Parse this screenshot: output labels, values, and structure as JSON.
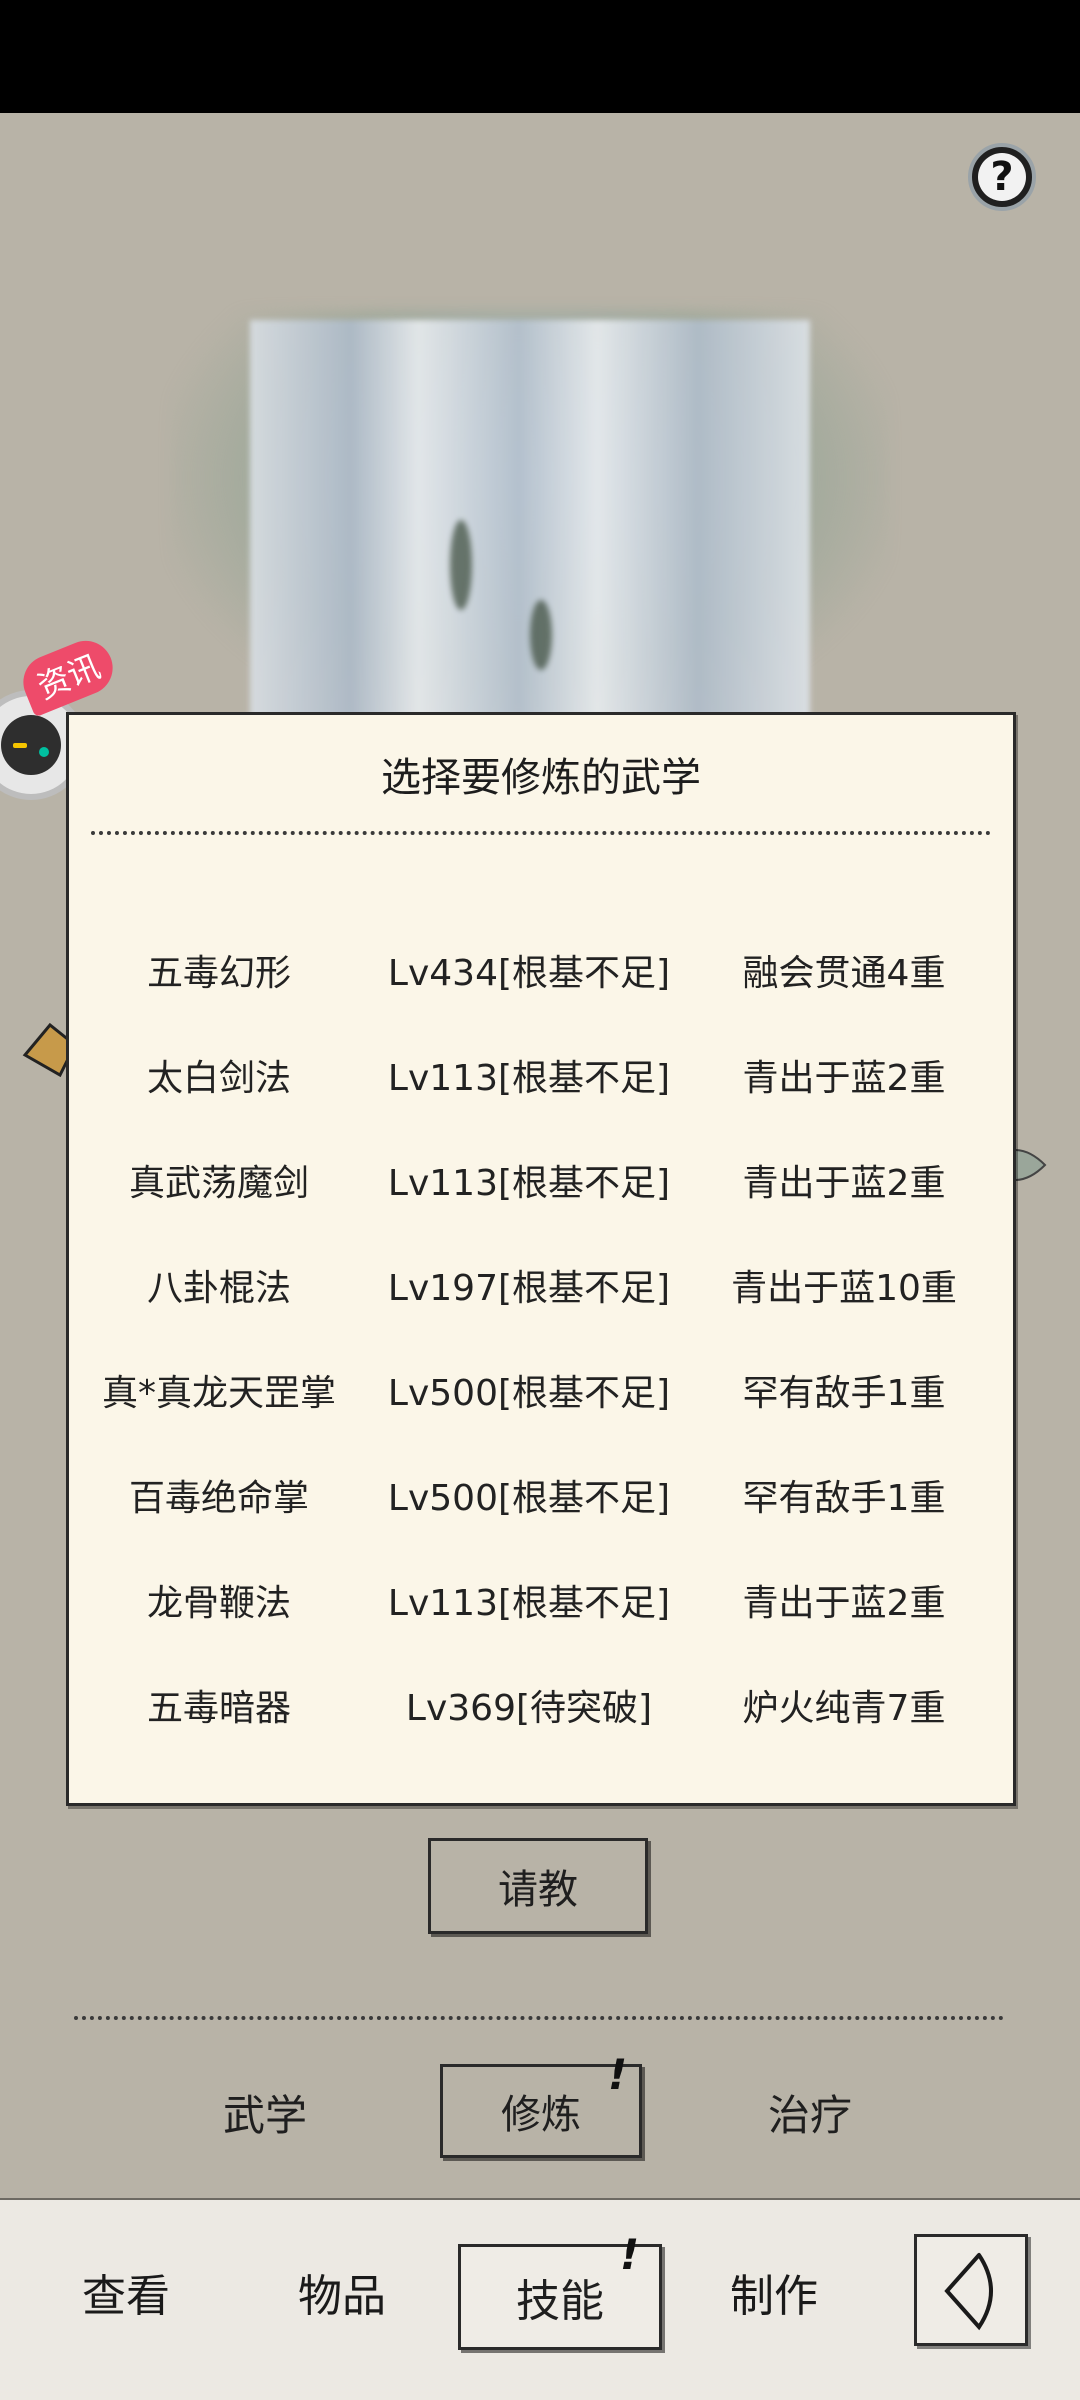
{
  "floating_widget": {
    "badge": "资讯",
    "icon": "gamepad-icon"
  },
  "help_button": {
    "icon": "question-mark-icon",
    "label": "?"
  },
  "dialog": {
    "title": "选择要修炼的武学",
    "rows": [
      {
        "name": "五毒幻形",
        "level": "Lv434[根基不足]",
        "realm": "融会贯通4重"
      },
      {
        "name": "太白剑法",
        "level": "Lv113[根基不足]",
        "realm": "青出于蓝2重"
      },
      {
        "name": "真武荡魔剑",
        "level": "Lv113[根基不足]",
        "realm": "青出于蓝2重"
      },
      {
        "name": "八卦棍法",
        "level": "Lv197[根基不足]",
        "realm": "青出于蓝10重"
      },
      {
        "name": "真*真龙天罡掌",
        "level": "Lv500[根基不足]",
        "realm": "罕有敌手1重"
      },
      {
        "name": "百毒绝命掌",
        "level": "Lv500[根基不足]",
        "realm": "罕有敌手1重"
      },
      {
        "name": "龙骨鞭法",
        "level": "Lv113[根基不足]",
        "realm": "青出于蓝2重"
      },
      {
        "name": "五毒暗器",
        "level": "Lv369[待突破]",
        "realm": "炉火纯青7重"
      }
    ]
  },
  "consult_button": "请教",
  "sub_tabs": {
    "martial": "武学",
    "cultivate": "修炼",
    "heal": "治疗",
    "alert_mark": "!"
  },
  "bottom_nav": {
    "view": "查看",
    "items": "物品",
    "skills": "技能",
    "craft": "制作",
    "alert_mark": "!",
    "back_icon": "back-arrow-icon"
  }
}
